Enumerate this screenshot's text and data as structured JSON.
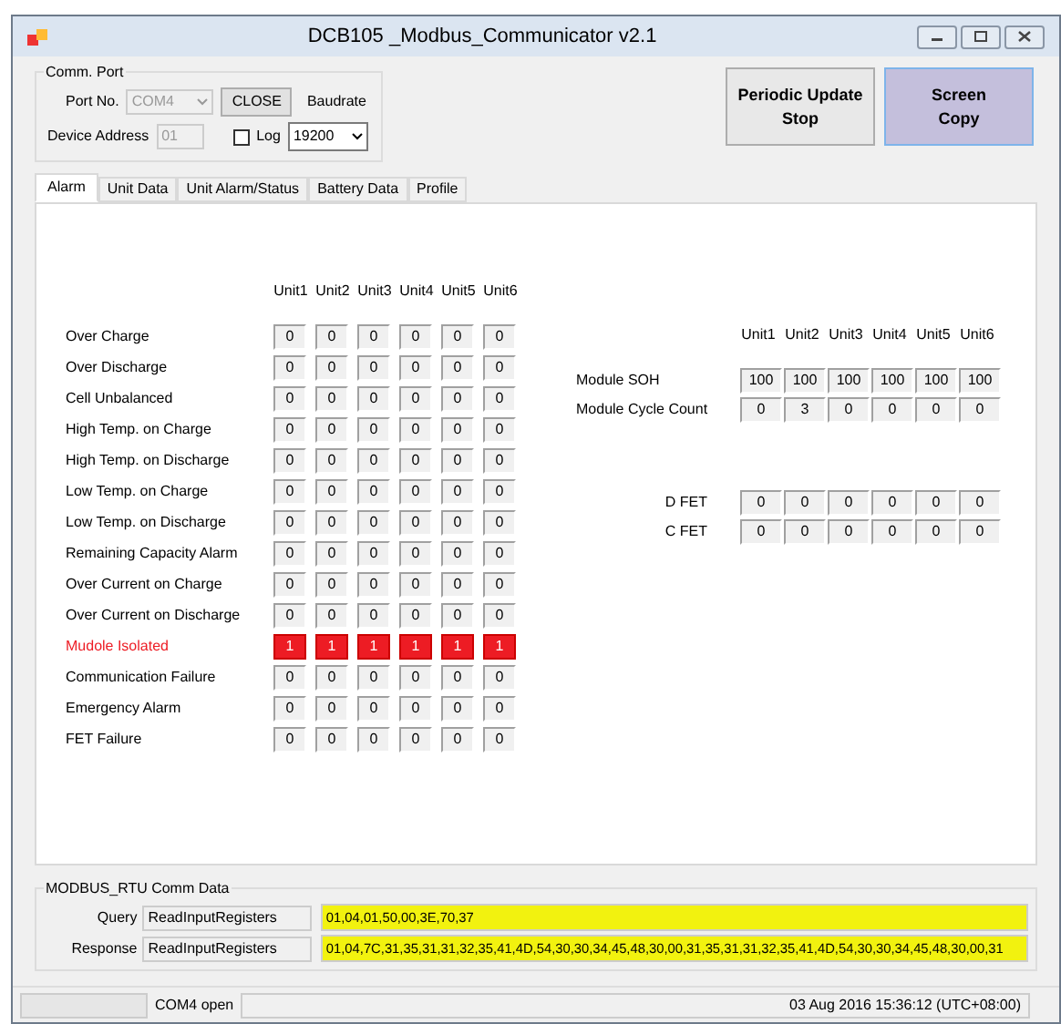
{
  "window": {
    "title": "DCB105 _Modbus_Communicator v2.1"
  },
  "comm_port": {
    "title": "Comm. Port",
    "port_label": "Port No.",
    "port_value": "COM4",
    "port_disabled": true,
    "close_button": "CLOSE",
    "baudrate_label": "Baudrate",
    "address_label": "Device Address",
    "address_value": "01",
    "log_label": "Log",
    "log_checked": false,
    "baudrate_value": "19200"
  },
  "buttons": [
    {
      "label": "Periodic Update Stop",
      "selected": false
    },
    {
      "label": "Screen Copy",
      "selected": true
    }
  ],
  "tabs": [
    {
      "label": "Alarm",
      "selected": true
    },
    {
      "label": "Unit Data",
      "selected": false
    },
    {
      "label": "Unit Alarm/Status",
      "selected": false
    },
    {
      "label": "Battery Data",
      "selected": false
    },
    {
      "label": "Profile",
      "selected": false
    }
  ],
  "alarm_table": {
    "columns": [
      "Unit1",
      "Unit2",
      "Unit3",
      "Unit4",
      "Unit5",
      "Unit6"
    ],
    "rows": [
      {
        "label": "Over Charge",
        "alarm": false,
        "values": [
          "0",
          "0",
          "0",
          "0",
          "0",
          "0"
        ]
      },
      {
        "label": "Over Discharge",
        "alarm": false,
        "values": [
          "0",
          "0",
          "0",
          "0",
          "0",
          "0"
        ]
      },
      {
        "label": "Cell Unbalanced",
        "alarm": false,
        "values": [
          "0",
          "0",
          "0",
          "0",
          "0",
          "0"
        ]
      },
      {
        "label": "High Temp. on Charge",
        "alarm": false,
        "values": [
          "0",
          "0",
          "0",
          "0",
          "0",
          "0"
        ]
      },
      {
        "label": "High Temp. on Discharge",
        "alarm": false,
        "values": [
          "0",
          "0",
          "0",
          "0",
          "0",
          "0"
        ]
      },
      {
        "label": "Low Temp. on Charge",
        "alarm": false,
        "values": [
          "0",
          "0",
          "0",
          "0",
          "0",
          "0"
        ]
      },
      {
        "label": "Low Temp. on Discharge",
        "alarm": false,
        "values": [
          "0",
          "0",
          "0",
          "0",
          "0",
          "0"
        ]
      },
      {
        "label": "Remaining Capacity Alarm",
        "alarm": false,
        "values": [
          "0",
          "0",
          "0",
          "0",
          "0",
          "0"
        ]
      },
      {
        "label": "Over Current on Charge",
        "alarm": false,
        "values": [
          "0",
          "0",
          "0",
          "0",
          "0",
          "0"
        ]
      },
      {
        "label": "Over Current on Discharge",
        "alarm": false,
        "values": [
          "0",
          "0",
          "0",
          "0",
          "0",
          "0"
        ]
      },
      {
        "label": "Mudole Isolated",
        "alarm": true,
        "values": [
          "1",
          "1",
          "1",
          "1",
          "1",
          "1"
        ]
      },
      {
        "label": "Communication Failure",
        "alarm": false,
        "values": [
          "0",
          "0",
          "0",
          "0",
          "0",
          "0"
        ]
      },
      {
        "label": "Emergency Alarm",
        "alarm": false,
        "values": [
          "0",
          "0",
          "0",
          "0",
          "0",
          "0"
        ]
      },
      {
        "label": "FET Failure",
        "alarm": false,
        "values": [
          "0",
          "0",
          "0",
          "0",
          "0",
          "0"
        ]
      }
    ]
  },
  "module_table": {
    "columns": [
      "Unit1",
      "Unit2",
      "Unit3",
      "Unit4",
      "Unit5",
      "Unit6"
    ],
    "rows": [
      {
        "label": "Module SOH",
        "values": [
          "100",
          "100",
          "100",
          "100",
          "100",
          "100"
        ]
      },
      {
        "label": "Module Cycle Count",
        "values": [
          "0",
          "3",
          "0",
          "0",
          "0",
          "0"
        ]
      }
    ]
  },
  "fet_table": {
    "rows": [
      {
        "label": "D FET",
        "values": [
          "0",
          "0",
          "0",
          "0",
          "0",
          "0"
        ]
      },
      {
        "label": "C FET",
        "values": [
          "0",
          "0",
          "0",
          "0",
          "0",
          "0"
        ]
      }
    ]
  },
  "comm_data": {
    "title": "MODBUS_RTU Comm Data",
    "rows": [
      {
        "label": "Query",
        "function": "ReadInputRegisters",
        "data": "01,04,01,50,00,3E,70,37"
      },
      {
        "label": "Response",
        "function": "ReadInputRegisters",
        "data": "01,04,7C,31,35,31,31,32,35,41,4D,54,30,30,34,45,48,30,00,31,35,31,31,32,35,41,4D,54,30,30,34,45,48,30,00,31"
      }
    ]
  },
  "status_bar": {
    "port_status": "COM4 open",
    "datetime": "03 Aug 2016 15:36:12 (UTC+08:00)"
  }
}
